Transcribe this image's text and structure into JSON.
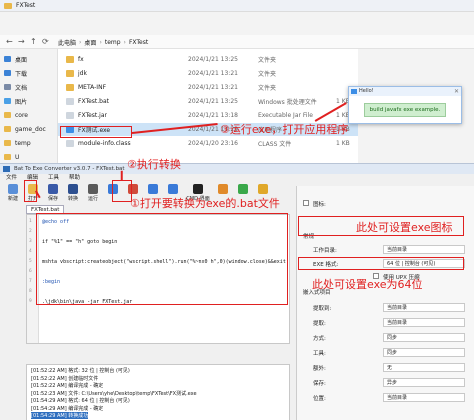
{
  "explorer": {
    "title": "FXTest",
    "breadcrumb": [
      "此电脑",
      "桌面",
      "temp",
      "FXTest"
    ],
    "sidebar": [
      {
        "label": "桌面",
        "color": "#3b82d6"
      },
      {
        "label": "下载",
        "color": "#3b82d6"
      },
      {
        "label": "文档",
        "color": "#7a8aa6"
      },
      {
        "label": "图片",
        "color": "#4aa0e6"
      },
      {
        "label": "core",
        "color": "#e9b84a"
      },
      {
        "label": "game_doc",
        "color": "#e9b84a"
      },
      {
        "label": "temp",
        "color": "#e9b84a"
      },
      {
        "label": "U",
        "color": "#e9b84a"
      }
    ],
    "files": [
      {
        "name": "fx",
        "date": "2024/1/21 13:25",
        "type": "文件夹",
        "size": ""
      },
      {
        "name": "jdk",
        "date": "2024/1/21 13:21",
        "type": "文件夹",
        "size": ""
      },
      {
        "name": "META-INF",
        "date": "2024/1/21 13:21",
        "type": "文件夹",
        "size": ""
      },
      {
        "name": "FXTest.bat",
        "date": "2024/1/21 13:25",
        "type": "Windows 批处理文件",
        "size": "1 KB"
      },
      {
        "name": "FXTest.jar",
        "date": "2024/1/21 13:18",
        "type": "Executable Jar File",
        "size": "1 KB"
      },
      {
        "name": "FX测试.exe",
        "date": "2024/1/21 13:29",
        "type": "应用程序",
        "size": "1 KB"
      },
      {
        "name": "module-info.class",
        "date": "2024/1/20 23:16",
        "type": "CLASS 文件",
        "size": "1 KB"
      }
    ]
  },
  "popup": {
    "title": "Hello!",
    "message": "build javafx exe example."
  },
  "converter": {
    "title": "Bat To Exe Converter v3.0.7 - FXTest.bat",
    "menu": [
      "文件",
      "编辑",
      "工具",
      "帮助"
    ],
    "toolbar": [
      {
        "label": "新建",
        "color": "#5a8fd8"
      },
      {
        "label": "打开",
        "color": "#e9b84a"
      },
      {
        "label": "保存",
        "color": "#3a5aa8"
      },
      {
        "label": "转换",
        "color": "#2d4f8f"
      },
      {
        "label": "运行",
        "color": "#5a5a5a"
      },
      {
        "label": "",
        "color": "#3a7ad8"
      },
      {
        "label": "",
        "color": "#d04a3a"
      },
      {
        "label": "",
        "color": "#3a7ad8"
      },
      {
        "label": "",
        "color": "#3a7ad8"
      },
      {
        "label": "CMD-界面",
        "color": "#222222"
      },
      {
        "label": "",
        "color": "#e08a2a"
      },
      {
        "label": "",
        "color": "#3aa84a"
      },
      {
        "label": "",
        "color": "#e0a82a"
      }
    ],
    "tab": "FXTest.bat",
    "code_lines": [
      "@echo off",
      "",
      "if \"%1\" == \"h\" goto begin",
      "",
      "mshta vbscript:createobject(\"wscript.shell\").run(\"%~nx0 h\",0)(window.close)&&exit",
      "",
      ":begin",
      "",
      ".\\jdk\\bin\\java -jar FXTest.jar"
    ],
    "log": [
      "[01:52:22 AM] 格式: 32 位 | 控制台 (可见)",
      "[01:52:22 AM] 创建临时文件",
      "[01:52:22 AM] 编译完成 - 确定",
      "[01:52:23 AM] 文件: C:\\Users\\yhe\\Desktop\\temp\\FXTest\\FX测试.exe",
      "[01:54:29 AM] 格式: 64 位 | 控制台 (可见)",
      "[01:54:29 AM] 编译完成 - 确定",
      "[01:54:29 AM] 转换成功"
    ]
  },
  "props": {
    "icon_label": "图标:",
    "general": "常规",
    "rows": [
      {
        "label": "工作目录:",
        "value": "当前目录"
      },
      {
        "label": "EXE 格式:",
        "value": "64 位 | 控制台 (可见)"
      }
    ],
    "upx": "使用 UPX 压缩",
    "section2": "嵌入式项目",
    "rows2": [
      {
        "label": "提取到:",
        "value": "当前目录"
      },
      {
        "label": "提取:",
        "value": "当前目录"
      },
      {
        "label": "方式:",
        "value": "同步"
      },
      {
        "label": "工具:",
        "value": "同步"
      },
      {
        "label": "额外:",
        "value": "无"
      },
      {
        "label": "保存:",
        "value": "异步"
      },
      {
        "label": "位置:",
        "value": "当前目录"
      }
    ]
  },
  "annotations": {
    "step1": "①打开要转换为exe的.bat文件",
    "step2": "②执行转换",
    "step3": "③运行exe，打开应用程序",
    "note_icon": "此处可设置exe图标",
    "note_format": "此处可设置exe为64位"
  },
  "colors": {
    "annotation_red": "#e02020",
    "selection_blue": "#cde3f7"
  }
}
